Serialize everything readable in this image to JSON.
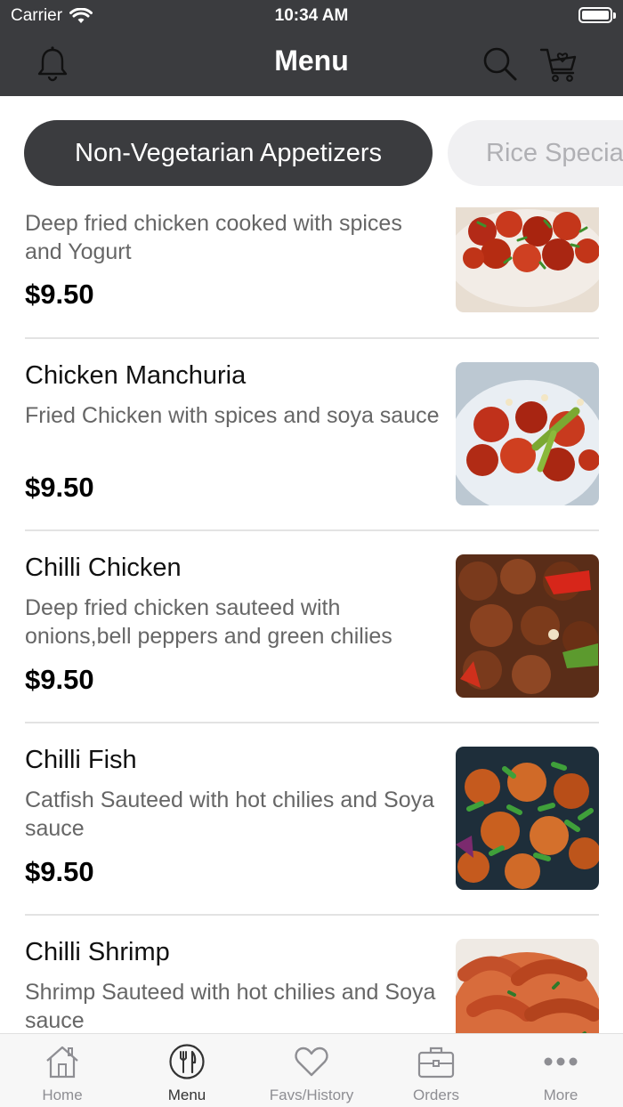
{
  "status_bar": {
    "carrier": "Carrier",
    "time": "10:34 AM"
  },
  "header": {
    "title": "Menu",
    "icons": [
      "bell-icon",
      "search-icon",
      "cart-icon"
    ]
  },
  "categories": [
    {
      "label": "Non-Vegetarian Appetizers",
      "selected": true
    },
    {
      "label": "Rice Specia",
      "selected": false
    }
  ],
  "menu_items": [
    {
      "name": "",
      "description": "Deep fried chicken cooked with spices and Yogurt",
      "price": "$9.50"
    },
    {
      "name": "Chicken Manchuria",
      "description": "Fried Chicken with spices and soya sauce",
      "price": "$9.50"
    },
    {
      "name": "Chilli Chicken",
      "description": "Deep fried chicken sauteed with onions,bell peppers and green chilies",
      "price": "$9.50"
    },
    {
      "name": "Chilli Fish",
      "description": "Catfish Sauteed with hot chilies and Soya sauce",
      "price": "$9.50"
    },
    {
      "name": "Chilli Shrimp",
      "description": "Shrimp Sauteed with hot chilies and Soya sauce",
      "price": ""
    }
  ],
  "tab_bar": [
    {
      "label": "Home",
      "icon": "home-icon",
      "selected": false
    },
    {
      "label": "Menu",
      "icon": "utensils-icon",
      "selected": true
    },
    {
      "label": "Favs/History",
      "icon": "heart-icon",
      "selected": false
    },
    {
      "label": "Orders",
      "icon": "briefcase-icon",
      "selected": false
    },
    {
      "label": "More",
      "icon": "more-icon",
      "selected": false
    }
  ],
  "colors": {
    "header_bg": "#3b3c3f",
    "pill_inactive_bg": "#f0f0f2",
    "tab_bar_bg": "#f7f7f7"
  }
}
